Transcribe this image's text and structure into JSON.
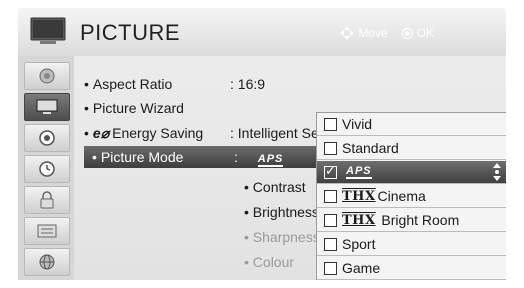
{
  "header": {
    "title": "PICTURE",
    "move_label": "Move",
    "ok_label": "OK"
  },
  "sidebar": {
    "items": [
      {
        "icon": "satellite-dish-icon"
      },
      {
        "icon": "tv-icon",
        "active": true
      },
      {
        "icon": "speaker-icon"
      },
      {
        "icon": "clock-icon"
      },
      {
        "icon": "lock-icon"
      },
      {
        "icon": "keyboard-icon"
      },
      {
        "icon": "globe-icon"
      }
    ]
  },
  "menu": {
    "aspect_ratio": {
      "label": "Aspect Ratio",
      "value": ": 16:9"
    },
    "picture_wizard": {
      "label": "Picture Wizard"
    },
    "energy_saving": {
      "logo": "e⌀",
      "label": "Energy Saving",
      "value": ": Intelligent Se"
    },
    "picture_mode": {
      "label": "Picture Mode",
      "value_prefix": ":",
      "value_logo": "APS"
    },
    "sub_items": [
      "• Contrast",
      "• Brightness",
      "• Sharpness",
      "• Colour"
    ]
  },
  "dropdown": {
    "options": [
      {
        "label": "Vivid"
      },
      {
        "label": "Standard"
      },
      {
        "logo": "APS",
        "selected": true
      },
      {
        "thx": "THX",
        "label": "Cinema"
      },
      {
        "thx": "THX",
        "label": " Bright Room"
      },
      {
        "label": "Sport"
      },
      {
        "label": "Game"
      }
    ]
  },
  "colors": {
    "selected_bg": "#4d4d4d",
    "frame_bg": "#e6e6e6",
    "dim_text": "#9a9a9a"
  }
}
